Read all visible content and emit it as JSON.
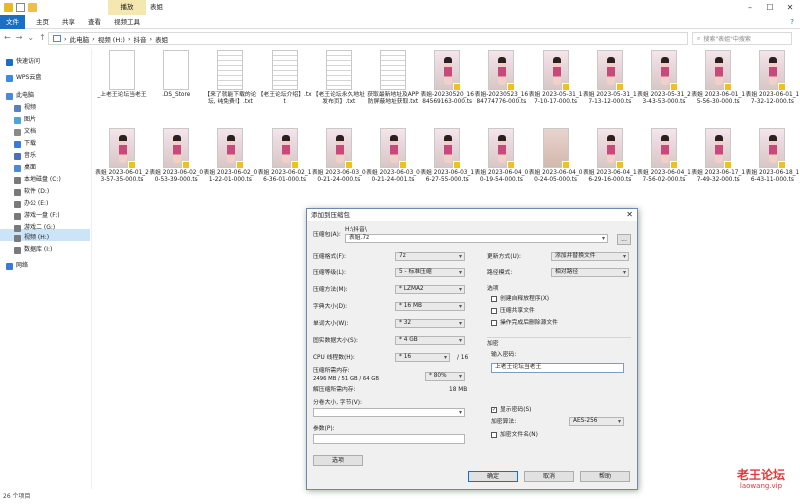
{
  "title_bar": {
    "context_tab": "播放",
    "title": "表姐"
  },
  "ribbon_tabs": [
    "文件",
    "主页",
    "共享",
    "查看",
    "视频工具"
  ],
  "address": {
    "path": [
      "此电脑",
      "视频 (H:)",
      "抖音",
      "表姐"
    ],
    "search_placeholder": "搜索\"表姐\"中搜索"
  },
  "nav": {
    "items": [
      {
        "label": "快速访问",
        "icon": "star-icon"
      },
      {
        "label": "WPS云盘",
        "icon": "cloud-icon"
      },
      {
        "label": "此电脑",
        "icon": "computer-icon"
      },
      {
        "label": "视频",
        "icon": "video-folder-icon"
      },
      {
        "label": "图片",
        "icon": "picture-folder-icon"
      },
      {
        "label": "文档",
        "icon": "document-folder-icon"
      },
      {
        "label": "下载",
        "icon": "download-folder-icon"
      },
      {
        "label": "音乐",
        "icon": "music-folder-icon"
      },
      {
        "label": "桌面",
        "icon": "desktop-folder-icon"
      },
      {
        "label": "本地磁盘 (C:)",
        "icon": "drive-icon"
      },
      {
        "label": "软件 (D:)",
        "icon": "drive-icon"
      },
      {
        "label": "办公 (E:)",
        "icon": "drive-icon"
      },
      {
        "label": "游戏一盘 (F:)",
        "icon": "drive-icon"
      },
      {
        "label": "游戏二 (G:)",
        "icon": "drive-icon"
      },
      {
        "label": "视频 (H:)",
        "icon": "drive-icon"
      },
      {
        "label": "数据库 (I:)",
        "icon": "drive-icon"
      },
      {
        "label": "网络",
        "icon": "network-icon"
      }
    ],
    "selected": "视频 (H:)"
  },
  "files": [
    {
      "name": "_上老王论坛当老王",
      "type": "blank"
    },
    {
      "name": ".DS_Store",
      "type": "blank"
    },
    {
      "name": "【来了就能下载的论坛, 纯免费!】.txt",
      "type": "text"
    },
    {
      "name": "【老王论坛介绍】.txt",
      "type": "text"
    },
    {
      "name": "【老王论坛永久地址发布页】.txt",
      "type": "text"
    },
    {
      "name": "获取最新地址及APP防屏蔽地址获取.txt",
      "type": "text"
    },
    {
      "name": "表姐-20230520_1684569163-000.ts",
      "type": "video"
    },
    {
      "name": "表姐-20230523_1684774776-000.ts",
      "type": "video"
    },
    {
      "name": "表姐 2023-05-31_17-10-17-000.ts",
      "type": "video"
    },
    {
      "name": "表姐 2023-05-31_17-13-12-000.ts",
      "type": "video"
    },
    {
      "name": "表姐 2023-05-31_23-43-53-000.ts",
      "type": "video"
    },
    {
      "name": "表姐 2023-06-01_15-56-30-000.ts",
      "type": "video"
    },
    {
      "name": "表姐 2023-06-01_17-32-12-000.ts",
      "type": "video"
    },
    {
      "name": "表姐 2023-06-01_23-57-35-000.ts",
      "type": "video"
    },
    {
      "name": "表姐 2023-06-02_00-53-39-000.ts",
      "type": "video"
    },
    {
      "name": "表姐 2023-06-02_01-22-01-000.ts",
      "type": "video"
    },
    {
      "name": "表姐 2023-06-02_16-36-01-000.ts",
      "type": "video"
    },
    {
      "name": "表姐 2023-06-03_00-21-24-000.ts",
      "type": "video"
    },
    {
      "name": "表姐 2023-06-03_00-21-24-001.ts",
      "type": "video"
    },
    {
      "name": "表姐 2023-06-03_16-27-55-000.ts",
      "type": "video"
    },
    {
      "name": "表姐 2023-06-04_00-19-54-000.ts",
      "type": "video"
    },
    {
      "name": "表姐 2023-06-04_00-24-05-000.ts",
      "type": "video-plain"
    },
    {
      "name": "表姐 2023-06-04_16-29-16-000.ts",
      "type": "video"
    },
    {
      "name": "表姐 2023-06-04_17-56-02-000.ts",
      "type": "video"
    },
    {
      "name": "表姐 2023-06-17_17-49-32-000.ts",
      "type": "video"
    },
    {
      "name": "表姐 2023-06-18_16-43-11-000.ts",
      "type": "video"
    }
  ],
  "status": "26 个项目",
  "dialog": {
    "title": "添加到压缩包",
    "archive_label": "压缩包(A):",
    "archive_dir": "H:\\抖音\\",
    "archive_name": "表姐.7z",
    "browse": "...",
    "left_rows": [
      {
        "label": "压缩格式(F):",
        "value": "7z"
      },
      {
        "label": "压缩等级(L):",
        "value": "5 - 标准压缩"
      },
      {
        "label": "压缩方法(M):",
        "value": "* LZMA2"
      },
      {
        "label": "字典大小(D):",
        "value": "* 16 MB"
      },
      {
        "label": "单词大小(W):",
        "value": "* 32"
      },
      {
        "label": "固实数据大小(S):",
        "value": "* 4 GB"
      }
    ],
    "threads_label": "CPU 线程数(H):",
    "threads_value": "* 16",
    "threads_total": "/ 16",
    "mem_label": "压缩所需内存:",
    "mem_detail": "2496 MB / 51 GB / 64 GB",
    "mem_value": "* 80%",
    "decomp_label": "解压缩所需内存:",
    "decomp_value": "18 MB",
    "split_label": "分卷大小, 字节(V):",
    "params_label": "参数(P):",
    "options_btn": "选项",
    "update_label": "更新方式(U):",
    "update_value": "添加并替换文件",
    "path_label": "路径模式:",
    "path_value": "相对路径",
    "options_group": "选项",
    "checks": [
      {
        "label": "创建自释放程序(X)",
        "checked": false
      },
      {
        "label": "压缩共享文件",
        "checked": false
      },
      {
        "label": "操作完成后删除源文件",
        "checked": false
      }
    ],
    "encrypt_group": "加密",
    "password_label": "输入密码:",
    "password_value": "上老王论坛当老王",
    "show_password": "显示密码(S)",
    "show_password_checked": true,
    "enc_method_label": "加密算法:",
    "enc_method_value": "AES-256",
    "encrypt_names": "加密文件名(N)",
    "encrypt_names_checked": false,
    "ok": "确定",
    "cancel": "取消",
    "help": "帮助"
  },
  "watermark": {
    "line1": "老王论坛",
    "line2": "laowang.vip"
  }
}
